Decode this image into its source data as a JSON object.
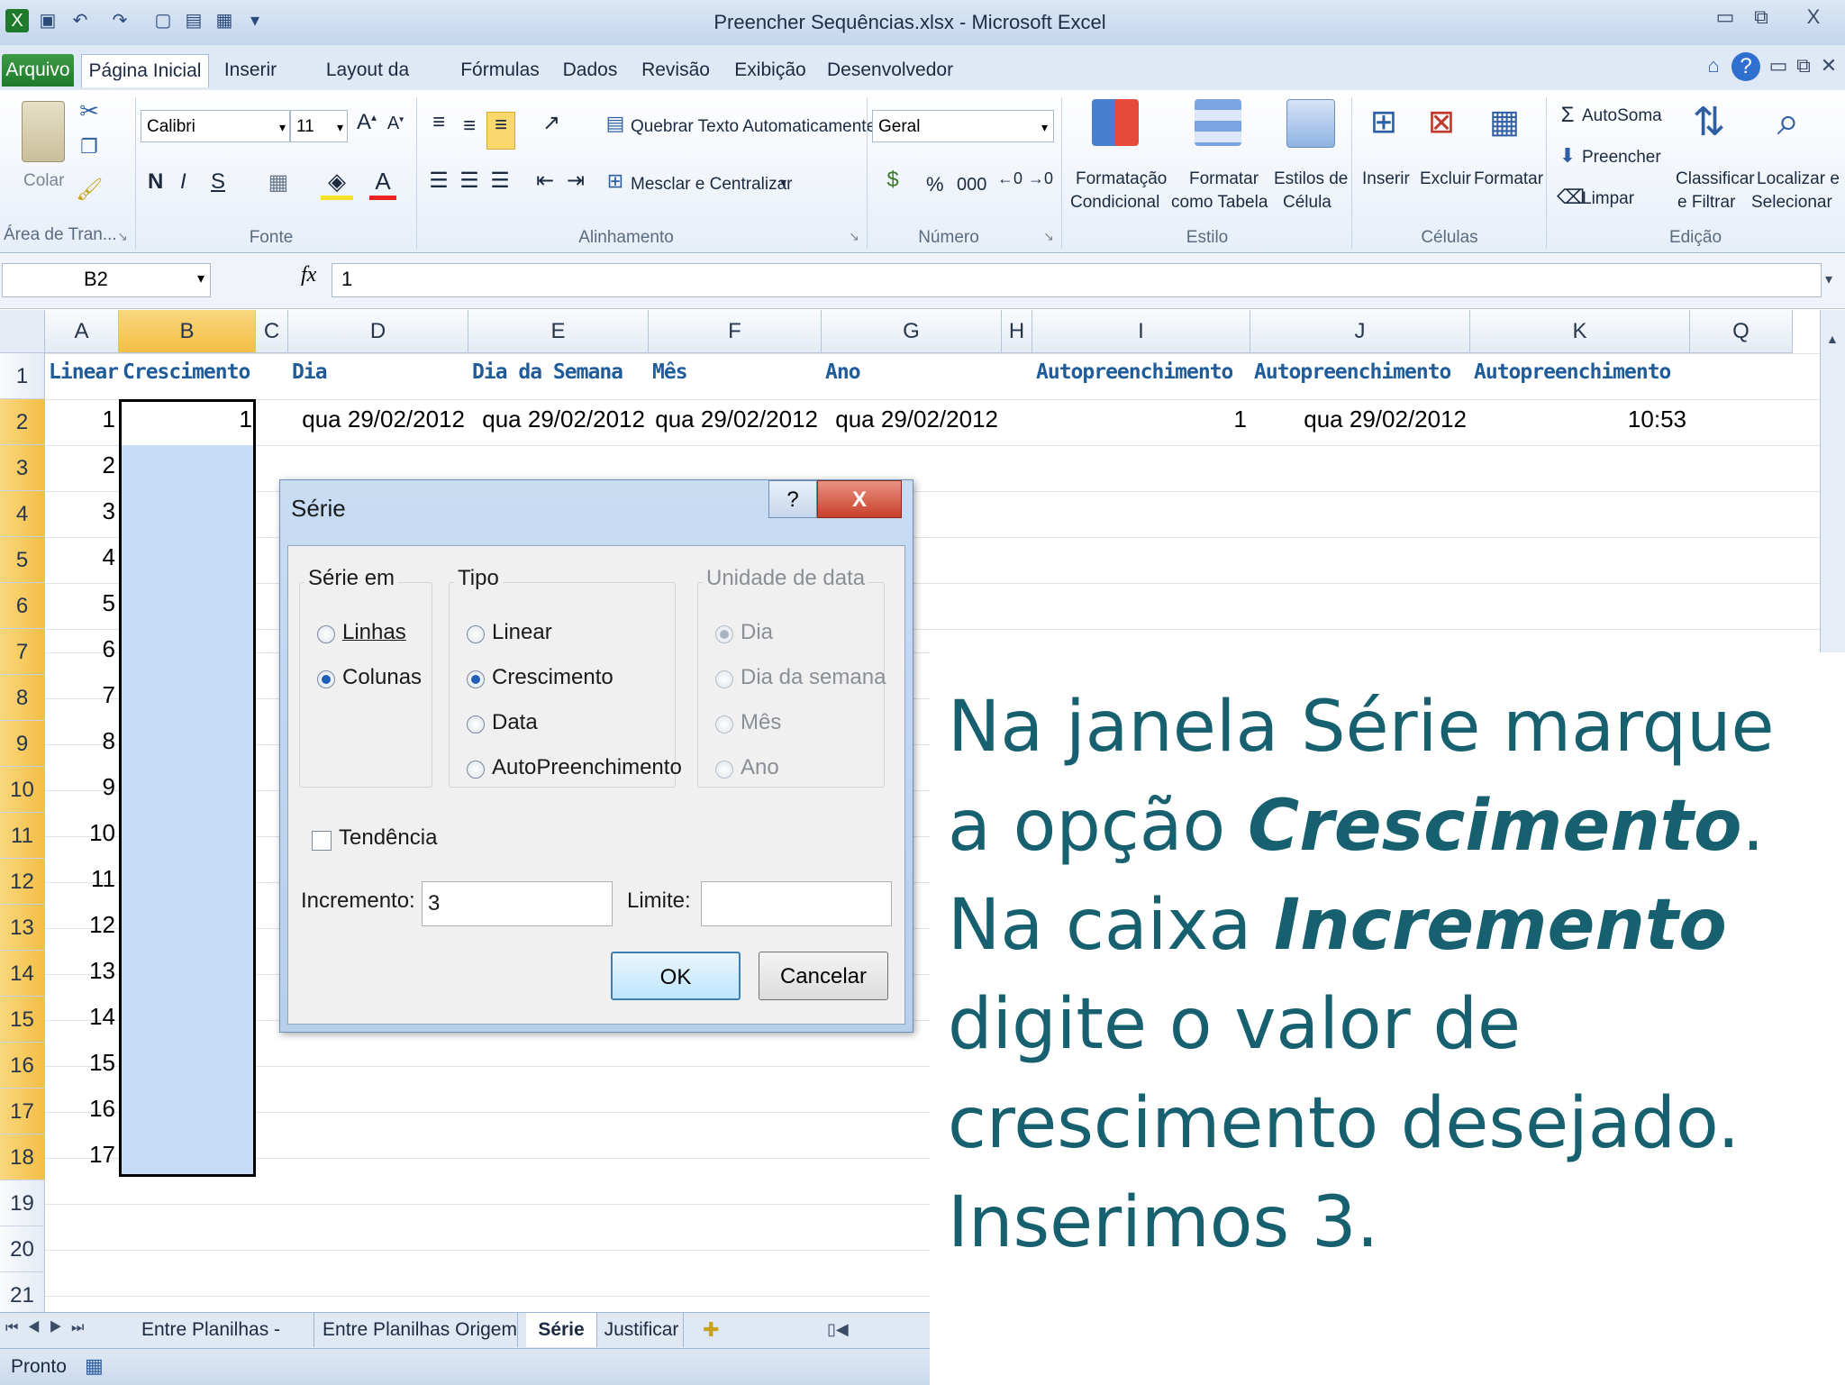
{
  "window": {
    "title": "Preencher Sequências.xlsx - Microsoft Excel",
    "controls": {
      "minimize": "▭",
      "restore": "⧉",
      "close": "X"
    }
  },
  "tabs": [
    "Arquivo",
    "Página Inicial",
    "Inserir",
    "Layout da Página",
    "Fórmulas",
    "Dados",
    "Revisão",
    "Exibição",
    "Desenvolvedor"
  ],
  "ribbon": {
    "clipboard": {
      "paste": "Colar",
      "label": "Área de Tran..."
    },
    "font": {
      "name": "Calibri",
      "size": "11",
      "bold": "N",
      "italic": "I",
      "underline": "S",
      "label": "Fonte"
    },
    "alignment": {
      "wrap": "Quebrar Texto Automaticamente",
      "merge": "Mesclar e Centralizar",
      "label": "Alinhamento"
    },
    "number": {
      "format": "Geral",
      "percent": "%",
      "thousands": "000",
      "label": "Número"
    },
    "styles": {
      "conditional_1": "Formatação",
      "conditional_2": "Condicional",
      "table_1": "Formatar",
      "table_2": "como Tabela",
      "cell_1": "Estilos de",
      "cell_2": "Célula",
      "label": "Estilo"
    },
    "cells": {
      "insert": "Inserir",
      "delete": "Excluir",
      "format": "Formatar",
      "label": "Células"
    },
    "editing": {
      "autosum": "AutoSoma",
      "fill": "Preencher",
      "clear": "Limpar",
      "sort_1": "Classificar",
      "sort_2": "e Filtrar",
      "find_1": "Localizar e",
      "find_2": "Selecionar",
      "label": "Edição"
    }
  },
  "formula_bar": {
    "name_box": "B2",
    "fx": "fx",
    "value": "1"
  },
  "grid": {
    "columns": [
      "A",
      "B",
      "C",
      "D",
      "E",
      "F",
      "G",
      "H",
      "I",
      "J",
      "K",
      "Q"
    ],
    "rows": [
      "1",
      "2",
      "3",
      "4",
      "5",
      "6",
      "7",
      "8",
      "9",
      "10",
      "11",
      "12",
      "13",
      "14",
      "15",
      "16",
      "17",
      "18",
      "19",
      "20",
      "21"
    ],
    "headers": {
      "A": "Linear",
      "B": "Crescimento",
      "D": "Dia",
      "E": "Dia da Semana",
      "F": "Mês",
      "G": "Ano",
      "I": "Autopreenchimento",
      "J": "Autopreenchimento",
      "K": "Autopreenchimento"
    },
    "row2": {
      "A": "1",
      "B": "1",
      "D": "qua 29/02/2012",
      "E": "qua 29/02/2012",
      "F": "qua 29/02/2012",
      "G": "qua 29/02/2012",
      "I": "1",
      "J": "qua 29/02/2012",
      "K": "10:53"
    },
    "column_A_values": [
      "2",
      "3",
      "4",
      "5",
      "6",
      "7",
      "8",
      "9",
      "10",
      "11",
      "12",
      "13",
      "14",
      "15",
      "16",
      "17"
    ]
  },
  "dialog": {
    "title": "Série",
    "help": "?",
    "close": "X",
    "series_in": {
      "title": "Série em",
      "options": [
        "Linhas",
        "Colunas"
      ],
      "selected": "Colunas"
    },
    "type": {
      "title": "Tipo",
      "options": [
        "Linear",
        "Crescimento",
        "Data",
        "AutoPreenchimento"
      ],
      "selected": "Crescimento"
    },
    "date_unit": {
      "title": "Unidade de data",
      "options": [
        "Dia",
        "Dia da semana",
        "Mês",
        "Ano"
      ],
      "selected": "Dia"
    },
    "trend": "Tendência",
    "increment_label": "Incremento:",
    "increment_value": "3",
    "limit_label": "Limite:",
    "limit_value": "",
    "ok": "OK",
    "cancel": "Cancelar"
  },
  "sheet_tabs": [
    "Entre Planilhas - Destino",
    "Entre Planilhas Origem",
    "Série",
    "Justificar"
  ],
  "status": "Pronto",
  "caption": {
    "p1": "Na janela Série marque a opção ",
    "b1": "Crescimento",
    "p2": ". Na caixa ",
    "b2": "Incremento",
    "p3": " digite o valor de crescimento desejado. Inserimos 3."
  }
}
